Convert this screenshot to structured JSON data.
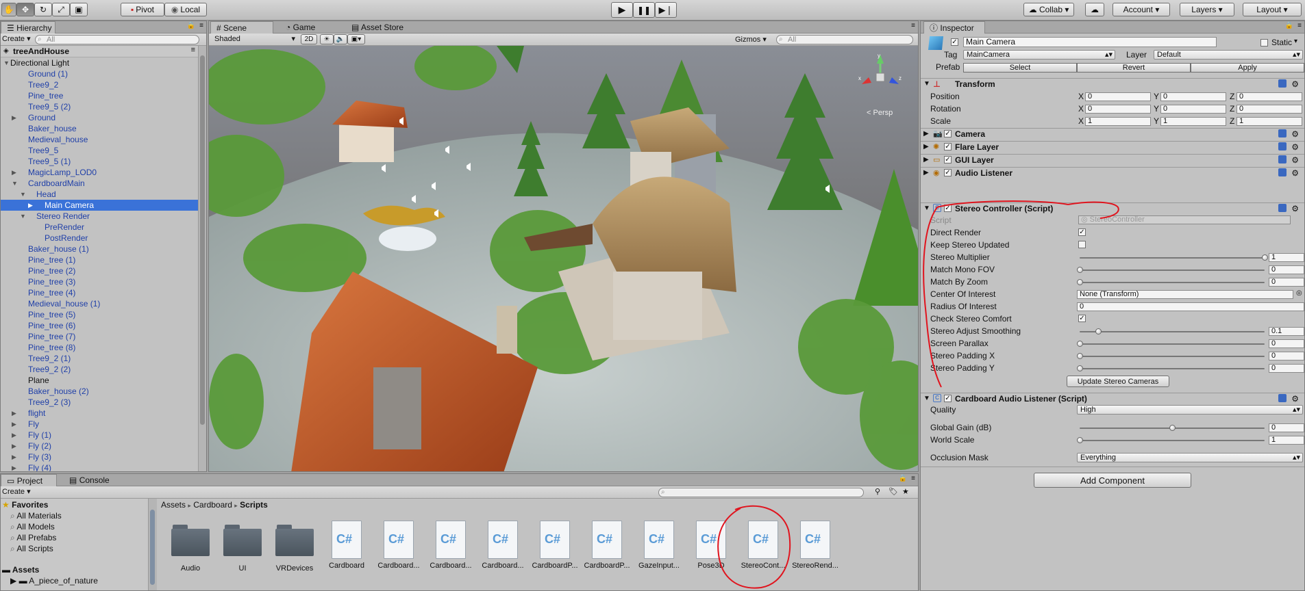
{
  "toolbar": {
    "pivot_label": "Pivot",
    "local_label": "Local",
    "collab_label": "Collab",
    "account_label": "Account",
    "layers_label": "Layers",
    "layout_label": "Layout"
  },
  "hierarchy": {
    "tab_label": "Hierarchy",
    "create_label": "Create",
    "search_placeholder": "All",
    "scene_name": "treeAndHouse",
    "items": [
      {
        "label": "Directional Light",
        "indent": 0,
        "arrow": "open",
        "color": "black"
      },
      {
        "label": "Ground (1)",
        "indent": 1,
        "arrow": "",
        "color": "blue"
      },
      {
        "label": "Tree9_2",
        "indent": 1,
        "arrow": "",
        "color": "blue"
      },
      {
        "label": "Pine_tree",
        "indent": 1,
        "arrow": "",
        "color": "blue"
      },
      {
        "label": "Tree9_5 (2)",
        "indent": 1,
        "arrow": "",
        "color": "blue"
      },
      {
        "label": "Ground",
        "indent": 1,
        "arrow": "closed",
        "color": "blue"
      },
      {
        "label": "Baker_house",
        "indent": 1,
        "arrow": "",
        "color": "blue"
      },
      {
        "label": "Medieval_house",
        "indent": 1,
        "arrow": "",
        "color": "blue"
      },
      {
        "label": "Tree9_5",
        "indent": 1,
        "arrow": "",
        "color": "blue"
      },
      {
        "label": "Tree9_5 (1)",
        "indent": 1,
        "arrow": "",
        "color": "blue"
      },
      {
        "label": "MagicLamp_LOD0",
        "indent": 1,
        "arrow": "closed",
        "color": "blue"
      },
      {
        "label": "CardboardMain",
        "indent": 1,
        "arrow": "open",
        "color": "blue"
      },
      {
        "label": "Head",
        "indent": 2,
        "arrow": "open",
        "color": "blue"
      },
      {
        "label": "Main Camera",
        "indent": 3,
        "arrow": "closed",
        "color": "blue",
        "selected": true
      },
      {
        "label": "Stereo Render",
        "indent": 2,
        "arrow": "open",
        "color": "blue"
      },
      {
        "label": "PreRender",
        "indent": 3,
        "arrow": "",
        "color": "blue"
      },
      {
        "label": "PostRender",
        "indent": 3,
        "arrow": "",
        "color": "blue"
      },
      {
        "label": "Baker_house (1)",
        "indent": 1,
        "arrow": "",
        "color": "blue"
      },
      {
        "label": "Pine_tree (1)",
        "indent": 1,
        "arrow": "",
        "color": "blue"
      },
      {
        "label": "Pine_tree (2)",
        "indent": 1,
        "arrow": "",
        "color": "blue"
      },
      {
        "label": "Pine_tree (3)",
        "indent": 1,
        "arrow": "",
        "color": "blue"
      },
      {
        "label": "Pine_tree (4)",
        "indent": 1,
        "arrow": "",
        "color": "blue"
      },
      {
        "label": "Medieval_house (1)",
        "indent": 1,
        "arrow": "",
        "color": "blue"
      },
      {
        "label": "Pine_tree (5)",
        "indent": 1,
        "arrow": "",
        "color": "blue"
      },
      {
        "label": "Pine_tree (6)",
        "indent": 1,
        "arrow": "",
        "color": "blue"
      },
      {
        "label": "Pine_tree (7)",
        "indent": 1,
        "arrow": "",
        "color": "blue"
      },
      {
        "label": "Pine_tree (8)",
        "indent": 1,
        "arrow": "",
        "color": "blue"
      },
      {
        "label": "Tree9_2 (1)",
        "indent": 1,
        "arrow": "",
        "color": "blue"
      },
      {
        "label": "Tree9_2 (2)",
        "indent": 1,
        "arrow": "",
        "color": "blue"
      },
      {
        "label": "Plane",
        "indent": 1,
        "arrow": "",
        "color": "black"
      },
      {
        "label": "Baker_house (2)",
        "indent": 1,
        "arrow": "",
        "color": "blue"
      },
      {
        "label": "Tree9_2 (3)",
        "indent": 1,
        "arrow": "",
        "color": "blue"
      },
      {
        "label": "flight",
        "indent": 1,
        "arrow": "closed",
        "color": "blue"
      },
      {
        "label": "Fly",
        "indent": 1,
        "arrow": "closed",
        "color": "blue"
      },
      {
        "label": "Fly (1)",
        "indent": 1,
        "arrow": "closed",
        "color": "blue"
      },
      {
        "label": "Fly (2)",
        "indent": 1,
        "arrow": "closed",
        "color": "blue"
      },
      {
        "label": "Fly (3)",
        "indent": 1,
        "arrow": "closed",
        "color": "blue"
      },
      {
        "label": "Fly (4)",
        "indent": 1,
        "arrow": "closed",
        "color": "blue"
      }
    ]
  },
  "scene": {
    "tabs": [
      "Scene",
      "Game",
      "Asset Store"
    ],
    "shading_mode": "Shaded",
    "mode_2d": "2D",
    "gizmos_label": "Gizmos",
    "search_placeholder": "All",
    "persp_label": "Persp",
    "gizmo_axes": [
      "x",
      "y",
      "z"
    ]
  },
  "inspector": {
    "tab_label": "Inspector",
    "object_name": "Main Camera",
    "static_label": "Static",
    "tag_label": "Tag",
    "tag_value": "MainCamera",
    "layer_label": "Layer",
    "layer_value": "Default",
    "prefab_label": "Prefab",
    "prefab_buttons": [
      "Select",
      "Revert",
      "Apply"
    ],
    "transform": {
      "title": "Transform",
      "rows": [
        {
          "label": "Position",
          "x": "0",
          "y": "0",
          "z": "0"
        },
        {
          "label": "Rotation",
          "x": "0",
          "y": "0",
          "z": "0"
        },
        {
          "label": "Scale",
          "x": "1",
          "y": "1",
          "z": "1"
        }
      ]
    },
    "components": [
      "Camera",
      "Flare Layer",
      "GUI Layer",
      "Audio Listener"
    ],
    "stereo": {
      "title": "Stereo Controller (Script)",
      "script_label": "Script",
      "script_value": "StereoController",
      "direct_render_label": "Direct Render",
      "direct_render": true,
      "keep_updated_label": "Keep Stereo Updated",
      "keep_updated": false,
      "multiplier_label": "Stereo Multiplier",
      "multiplier_value": "1",
      "multiplier_level": 1.0,
      "mono_fov_label": "Match Mono FOV",
      "mono_fov_value": "0",
      "zoom_label": "Match By Zoom",
      "zoom_value": "0",
      "center_label": "Center Of Interest",
      "center_value": "None (Transform)",
      "radius_label": "Radius Of Interest",
      "radius_value": "0",
      "comfort_label": "Check Stereo Comfort",
      "comfort": true,
      "smoothing_label": "Stereo Adjust Smoothing",
      "smoothing_value": "0.1",
      "smoothing_level": 0.1,
      "parallax_label": "Screen Parallax",
      "parallax_value": "0",
      "padx_label": "Stereo Padding X",
      "padx_value": "0",
      "pady_label": "Stereo Padding Y",
      "pady_value": "0",
      "update_button": "Update Stereo Cameras"
    },
    "audio": {
      "title": "Cardboard Audio Listener (Script)",
      "quality_label": "Quality",
      "quality_value": "High",
      "gain_label": "Global Gain (dB)",
      "gain_value": "0",
      "gain_level": 0.5,
      "world_label": "World Scale",
      "world_value": "1",
      "occlusion_label": "Occlusion Mask",
      "occlusion_value": "Everything"
    },
    "add_component": "Add Component"
  },
  "project": {
    "tabs": [
      "Project",
      "Console"
    ],
    "create_label": "Create",
    "favorites_label": "Favorites",
    "favorites": [
      "All Materials",
      "All Models",
      "All Prefabs",
      "All Scripts"
    ],
    "assets_label": "Assets",
    "asset_folders": [
      "A_piece_of_nature"
    ],
    "breadcrumb": [
      "Assets",
      "Cardboard",
      "Scripts"
    ],
    "items": [
      {
        "label": "Audio",
        "kind": "folder"
      },
      {
        "label": "UI",
        "kind": "folder"
      },
      {
        "label": "VRDevices",
        "kind": "folder"
      },
      {
        "label": "Cardboard",
        "kind": "script"
      },
      {
        "label": "Cardboard...",
        "kind": "script"
      },
      {
        "label": "Cardboard...",
        "kind": "script"
      },
      {
        "label": "Cardboard...",
        "kind": "script"
      },
      {
        "label": "CardboardP...",
        "kind": "script"
      },
      {
        "label": "CardboardP...",
        "kind": "script"
      },
      {
        "label": "GazeInput...",
        "kind": "script"
      },
      {
        "label": "Pose3D",
        "kind": "script"
      },
      {
        "label": "StereoCont...",
        "kind": "script"
      },
      {
        "label": "StereoRend...",
        "kind": "script"
      }
    ],
    "script_glyph": "C#"
  },
  "colors": {
    "selection": "#3a72d8",
    "hierarchy_blue": "#1f3fa8",
    "annotation_red": "#e0141e",
    "sky_top": "#7a7f89",
    "ground": "#b9c3c2"
  }
}
